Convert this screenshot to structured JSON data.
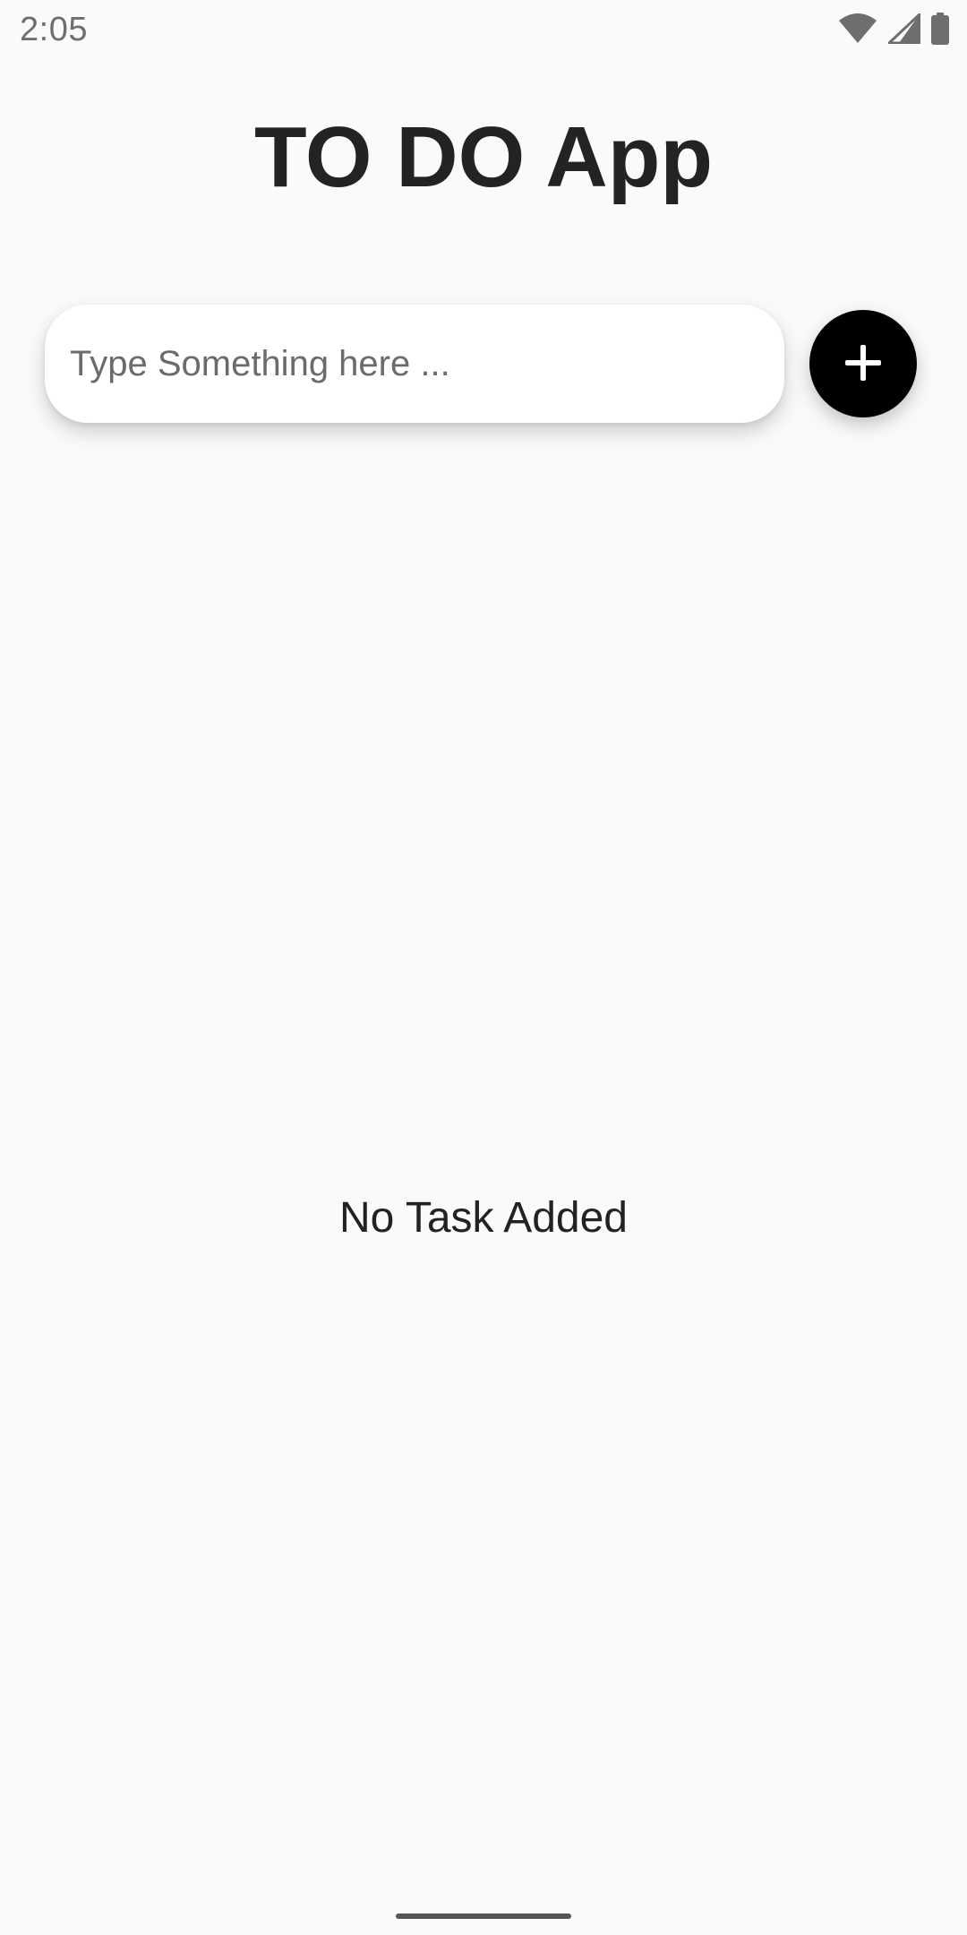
{
  "status_bar": {
    "time": "2:05",
    "icons": [
      "wifi-icon",
      "cellular-signal-icon",
      "battery-icon"
    ]
  },
  "header": {
    "title": "TO DO App"
  },
  "task_input": {
    "value": "",
    "placeholder": "Type Something here ...",
    "add_button_icon": "plus-icon"
  },
  "task_list": {
    "items": [],
    "empty_message": "No Task Added"
  },
  "colors": {
    "background": "#fafafa",
    "accent": "#000000",
    "input_background": "#ffffff",
    "title_text": "#232323",
    "status_text": "#6e6e6e"
  }
}
